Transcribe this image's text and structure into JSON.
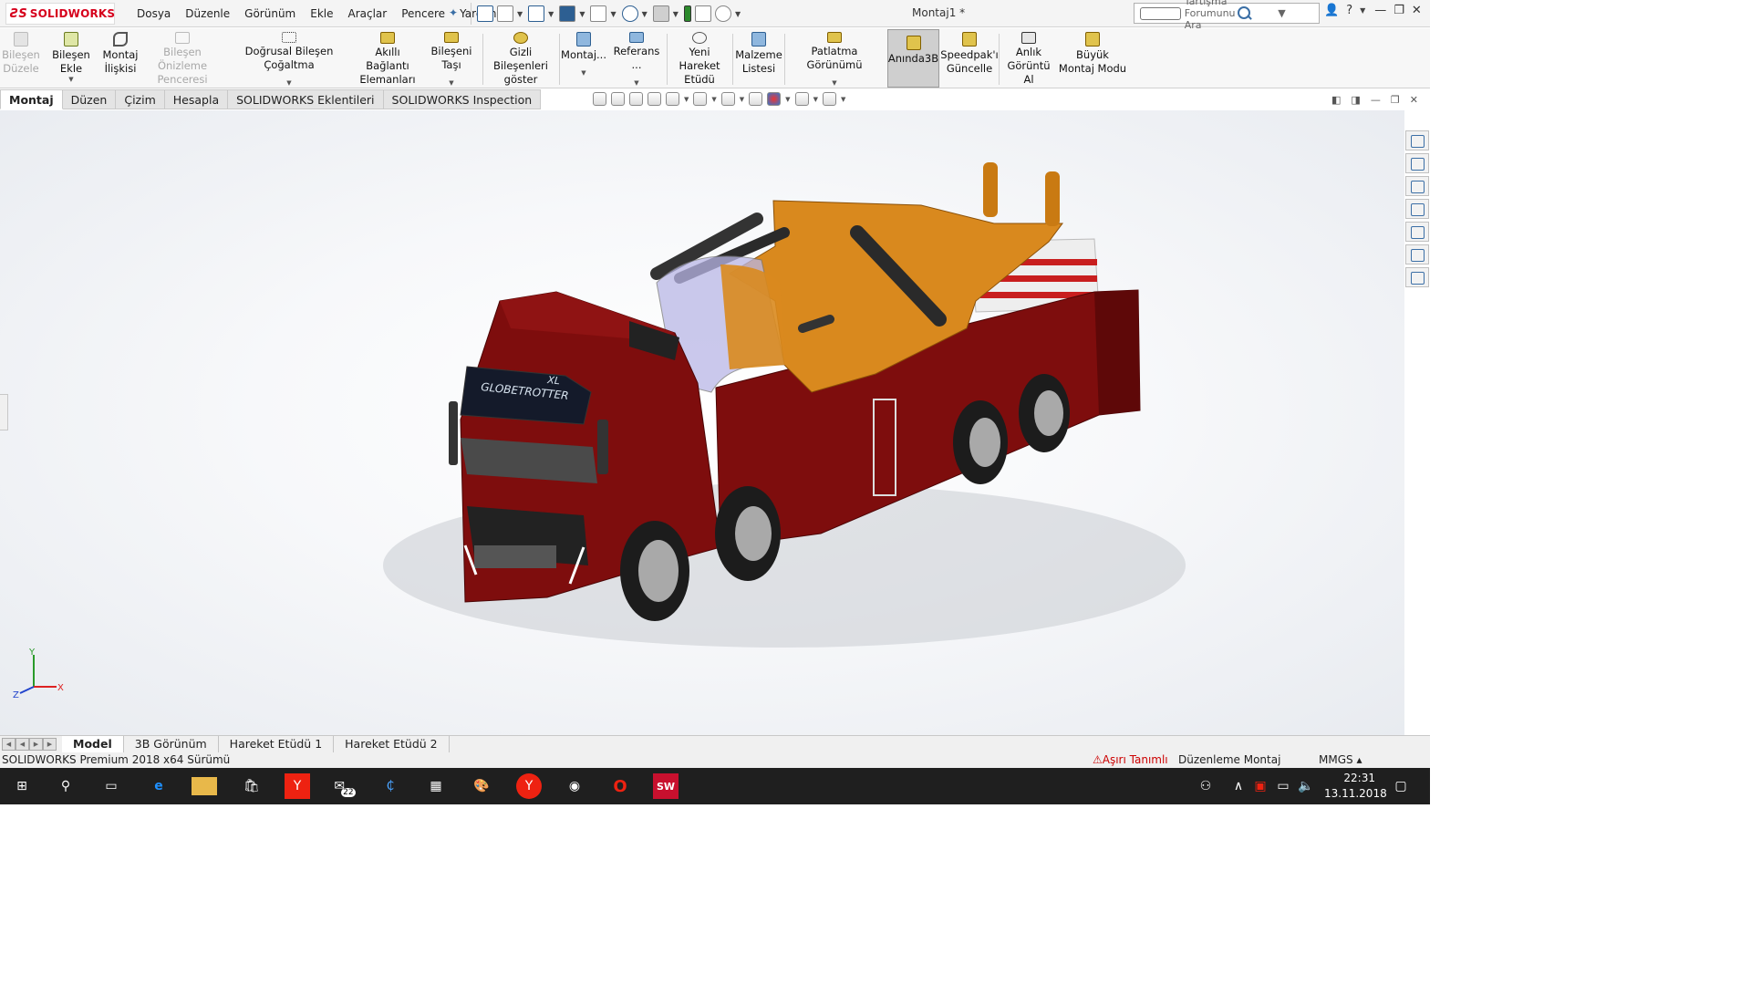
{
  "app": {
    "brand": "SOLIDWORKS",
    "doc_title": "Montaj1 *",
    "brand_color": "#d6001c"
  },
  "menu": [
    "Dosya",
    "Düzenle",
    "Görünüm",
    "Ekle",
    "Araçlar",
    "Pencere",
    "Yardım"
  ],
  "search": {
    "placeholder": "Tartışma Forumunu Ara"
  },
  "commands": [
    {
      "id": "bilesen-duzele",
      "label": "Bileşen Düzele",
      "disabled": true,
      "icon": "edit-component-icon"
    },
    {
      "id": "bilesen-ekle",
      "label": "Bileşen Ekle",
      "icon": "insert-components-icon",
      "dropdown": true
    },
    {
      "id": "montaj-iliskisi",
      "label": "Montaj İlişkisi",
      "icon": "mate-icon"
    },
    {
      "id": "bilesen-onizleme",
      "label": "Bileşen Önizleme Penceresi",
      "disabled": true,
      "icon": "component-preview-icon"
    },
    {
      "id": "dogrusal-cogaltma",
      "label": "Doğrusal Bileşen Çoğaltma",
      "icon": "linear-pattern-icon",
      "dropdown": true
    },
    {
      "id": "akilli-baglanti",
      "label": "Akıllı Bağlantı Elemanları",
      "icon": "smart-fasteners-icon"
    },
    {
      "id": "bileseni-tasi",
      "label": "Bileşeni Taşı",
      "icon": "move-component-icon",
      "dropdown": true
    },
    {
      "id": "gizli-bilesenler",
      "label": "Gizli Bileşenleri göster",
      "icon": "show-hidden-icon"
    },
    {
      "id": "montaj",
      "label": "Montaj...",
      "icon": "assembly-features-icon",
      "dropdown": true
    },
    {
      "id": "referans",
      "label": "Referans ...",
      "icon": "reference-geometry-icon",
      "dropdown": true
    },
    {
      "id": "yeni-hareket",
      "label": "Yeni Hareket Etüdü",
      "icon": "motion-study-icon"
    },
    {
      "id": "malzeme-listesi",
      "label": "Malzeme Listesi",
      "icon": "bom-icon"
    },
    {
      "id": "patlatma",
      "label": "Patlatma Görünümü",
      "icon": "exploded-view-icon",
      "dropdown": true
    },
    {
      "id": "aninda3b",
      "label": "Anında3B",
      "icon": "instant3d-icon",
      "selected": true
    },
    {
      "id": "speedpak",
      "label": "Speedpak'ı Güncelle",
      "icon": "speedpak-icon"
    },
    {
      "id": "anlik-goruntu",
      "label": "Anlık Görüntü Al",
      "icon": "snapshot-icon"
    },
    {
      "id": "buyuk-montaj",
      "label": "Büyük Montaj Modu",
      "icon": "large-assembly-icon"
    }
  ],
  "tabs": [
    "Montaj",
    "Düzen",
    "Çizim",
    "Hesapla",
    "SOLIDWORKS Eklentileri",
    "SOLIDWORKS Inspection"
  ],
  "model": {
    "cab_text": "GLOBETROTTER",
    "cab_badge": "XL"
  },
  "triad": {
    "x": "X",
    "y": "Y",
    "z": "Z"
  },
  "bottom_tabs": [
    "Model",
    "3B Görünüm",
    "Hareket Etüdü 1",
    "Hareket Etüdü 2"
  ],
  "status": {
    "version": "SOLIDWORKS Premium 2018 x64 Sürümü",
    "warning": "Aşırı Tanımlı",
    "mode": "Düzenleme Montaj",
    "units": "MMGS"
  },
  "taskbar": {
    "mail_badge": "22",
    "sw_badge": "SW",
    "time": "22:31",
    "date": "13.11.2018"
  }
}
